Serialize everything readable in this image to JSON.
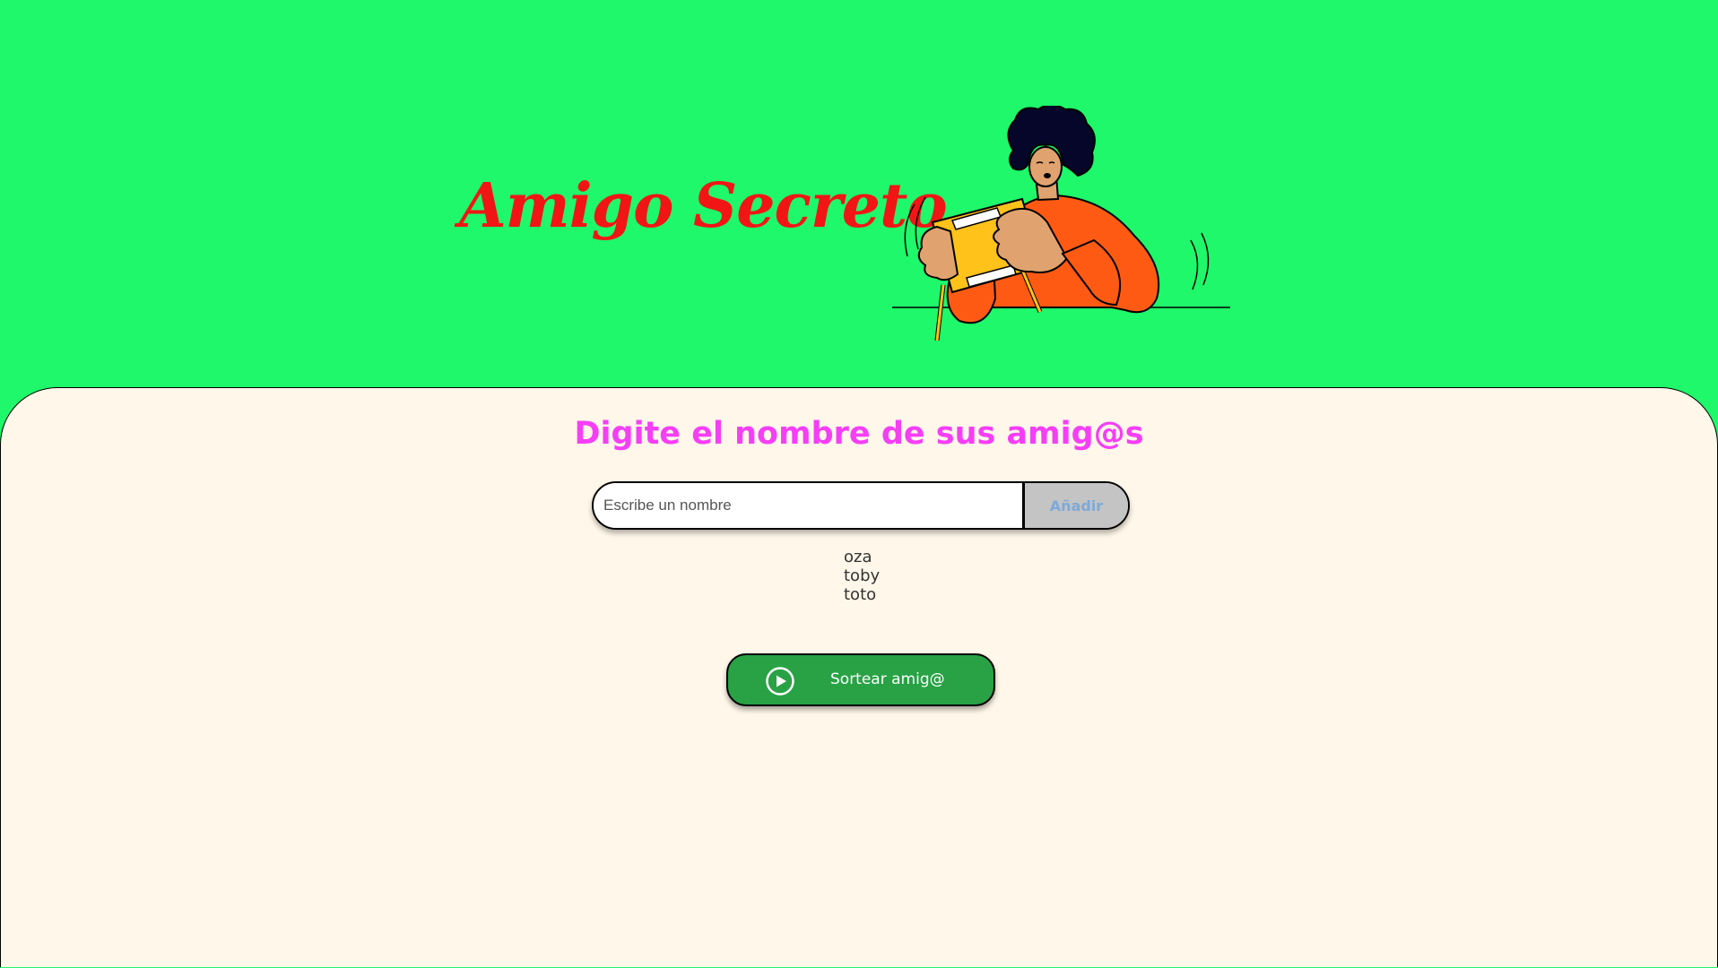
{
  "header": {
    "title": "Amigo Secreto"
  },
  "main": {
    "subtitle": "Digite el nombre de sus amig@s",
    "input": {
      "placeholder": "Escribe un nombre",
      "value": ""
    },
    "add_button_label": "Añadir",
    "friends": [
      "oza",
      "toby",
      "toto"
    ],
    "draw_button_label": "Sortear amig@"
  },
  "icons": {
    "draw_button_icon": "play-circle-icon",
    "illustration": "person-shaking-gift-illustration"
  },
  "colors": {
    "header_background": "#1ef86a",
    "panel_background": "#fff7e9",
    "title": "#f21515",
    "subtitle": "#f53ef7",
    "draw_button": "#28a245",
    "add_button": "#c4c4c4",
    "add_button_text": "#7ea9d8"
  }
}
